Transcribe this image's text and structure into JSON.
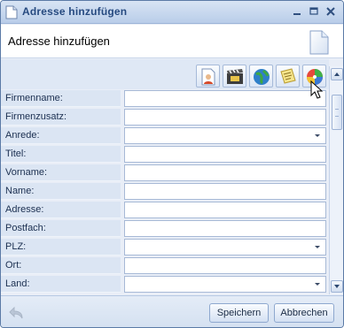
{
  "window": {
    "title": "Adresse hinzufügen"
  },
  "header": {
    "title": "Adresse hinzufügen",
    "icon": "document-icon"
  },
  "toolbar": {
    "buttons": [
      {
        "icon": "person-document-icon"
      },
      {
        "icon": "film-clapper-icon"
      },
      {
        "icon": "globe-icon"
      },
      {
        "icon": "notes-icon"
      },
      {
        "icon": "color-disc-icon"
      }
    ]
  },
  "form": {
    "fields": [
      {
        "label": "Firmenname:",
        "value": "",
        "type": "text"
      },
      {
        "label": "Firmenzusatz:",
        "value": "",
        "type": "text"
      },
      {
        "label": "Anrede:",
        "value": "",
        "type": "combo"
      },
      {
        "label": "Titel:",
        "value": "",
        "type": "text"
      },
      {
        "label": "Vorname:",
        "value": "",
        "type": "text"
      },
      {
        "label": "Name:",
        "value": "",
        "type": "text"
      },
      {
        "label": "Adresse:",
        "value": "",
        "type": "text"
      },
      {
        "label": "Postfach:",
        "value": "",
        "type": "text"
      },
      {
        "label": "PLZ:",
        "value": "",
        "type": "combo"
      },
      {
        "label": "Ort:",
        "value": "",
        "type": "text"
      },
      {
        "label": "Land:",
        "value": "",
        "type": "combo"
      }
    ]
  },
  "footer": {
    "save_label": "Speichern",
    "cancel_label": "Abbrechen"
  }
}
